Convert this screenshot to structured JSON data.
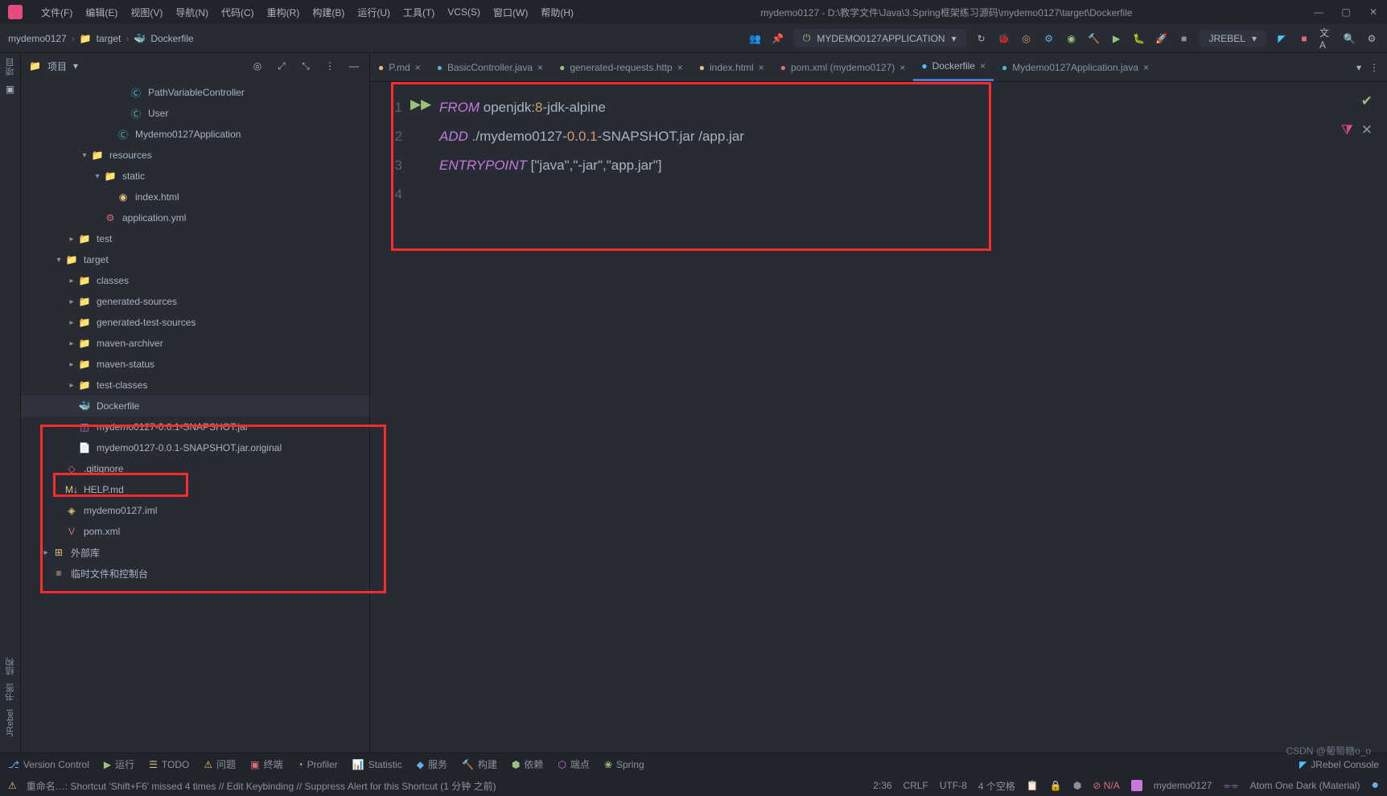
{
  "window": {
    "title": "mydemo0127 - D:\\教学文件\\Java\\3.Spring框架练习源码\\mydemo0127\\target\\Dockerfile"
  },
  "menus": [
    "文件(F)",
    "编辑(E)",
    "视图(V)",
    "导航(N)",
    "代码(C)",
    "重构(R)",
    "构建(B)",
    "运行(U)",
    "工具(T)",
    "VCS(S)",
    "窗口(W)",
    "帮助(H)"
  ],
  "breadcrumb": {
    "project": "mydemo0127",
    "folder": "target",
    "file": "Dockerfile"
  },
  "run_config": "MYDEMO0127APPLICATION",
  "jrebel_label": "JREBEL",
  "project_panel": {
    "title": "项目"
  },
  "tree": [
    {
      "indent": 120,
      "arrow": "",
      "icon": "class",
      "name": "PathVariableController"
    },
    {
      "indent": 120,
      "arrow": "",
      "icon": "class",
      "name": "User"
    },
    {
      "indent": 104,
      "arrow": "",
      "icon": "class",
      "name": "Mydemo0127Application"
    },
    {
      "indent": 72,
      "arrow": "▾",
      "icon": "folder-r",
      "name": "resources"
    },
    {
      "indent": 88,
      "arrow": "▾",
      "icon": "folder",
      "name": "static"
    },
    {
      "indent": 104,
      "arrow": "",
      "icon": "html",
      "name": "index.html"
    },
    {
      "indent": 88,
      "arrow": "",
      "icon": "yml",
      "name": "application.yml"
    },
    {
      "indent": 56,
      "arrow": "▸",
      "icon": "folder",
      "name": "test"
    },
    {
      "indent": 40,
      "arrow": "▾",
      "icon": "folder",
      "name": "target"
    },
    {
      "indent": 56,
      "arrow": "▸",
      "icon": "folder-p",
      "name": "classes"
    },
    {
      "indent": 56,
      "arrow": "▸",
      "icon": "folder-p",
      "name": "generated-sources"
    },
    {
      "indent": 56,
      "arrow": "▸",
      "icon": "folder-p",
      "name": "generated-test-sources"
    },
    {
      "indent": 56,
      "arrow": "▸",
      "icon": "folder-p",
      "name": "maven-archiver"
    },
    {
      "indent": 56,
      "arrow": "▸",
      "icon": "folder-p",
      "name": "maven-status"
    },
    {
      "indent": 56,
      "arrow": "▸",
      "icon": "folder-p",
      "name": "test-classes"
    },
    {
      "indent": 56,
      "arrow": "",
      "icon": "docker",
      "name": "Dockerfile",
      "selected": true,
      "boxed": true
    },
    {
      "indent": 56,
      "arrow": "",
      "icon": "jar",
      "name": "mydemo0127-0.0.1-SNAPSHOT.jar"
    },
    {
      "indent": 56,
      "arrow": "",
      "icon": "file",
      "name": "mydemo0127-0.0.1-SNAPSHOT.jar.original"
    },
    {
      "indent": 40,
      "arrow": "",
      "icon": "git",
      "name": ".gitignore"
    },
    {
      "indent": 40,
      "arrow": "",
      "icon": "md",
      "name": "HELP.md"
    },
    {
      "indent": 40,
      "arrow": "",
      "icon": "iml",
      "name": "mydemo0127.iml"
    },
    {
      "indent": 40,
      "arrow": "",
      "icon": "xml",
      "name": "pom.xml"
    },
    {
      "indent": 24,
      "arrow": "▸",
      "icon": "lib",
      "name": "外部库"
    },
    {
      "indent": 24,
      "arrow": "",
      "icon": "scratch",
      "name": "临时文件和控制台"
    }
  ],
  "tabs": [
    {
      "label": "P.md",
      "icon": "md",
      "close": true
    },
    {
      "label": "BasicController.java",
      "icon": "class",
      "close": true
    },
    {
      "label": "generated-requests.http",
      "icon": "http",
      "close": true
    },
    {
      "label": "index.html",
      "icon": "html",
      "close": true
    },
    {
      "label": "pom.xml (mydemo0127)",
      "icon": "xml",
      "close": true
    },
    {
      "label": "Dockerfile",
      "icon": "docker",
      "close": true,
      "active": true
    },
    {
      "label": "Mydemo0127Application.java",
      "icon": "class",
      "close": true
    }
  ],
  "code": {
    "l1": {
      "kw": "FROM",
      "rest": " openjdk:",
      "n1": "8",
      "t1": "-jdk-alpine"
    },
    "l2": {
      "kw": "ADD",
      "rest": " ./mydemo0127-",
      "n1": "0",
      "d1": ".",
      "n2": "0",
      "d2": ".",
      "n3": "1",
      "t1": "-SNAPSHOT.jar /app.jar"
    },
    "l3": {
      "kw": "ENTRYPOINT",
      "rest": " [\"java\",\"-jar\",\"app.jar\"]"
    }
  },
  "lines": [
    "1",
    "2",
    "3",
    "4"
  ],
  "bottom_tools": [
    "Version Control",
    "运行",
    "TODO",
    "问题",
    "终端",
    "Profiler",
    "Statistic",
    "服务",
    "构建",
    "依赖",
    "端点",
    "Spring"
  ],
  "bottom_right": "JRebel Console",
  "status": {
    "msg": "重命名…: Shortcut 'Shift+F6' missed 4 times // Edit Keybinding // Suppress Alert for this Shortcut (1 分钟 之前)",
    "pos": "2:36",
    "eol": "CRLF",
    "enc": "UTF-8",
    "indent": "4 个空格",
    "na": "N/A",
    "project": "mydemo0127",
    "theme": "Atom One Dark (Material)"
  },
  "watermark": "CSDN @葡萄糖o_o"
}
